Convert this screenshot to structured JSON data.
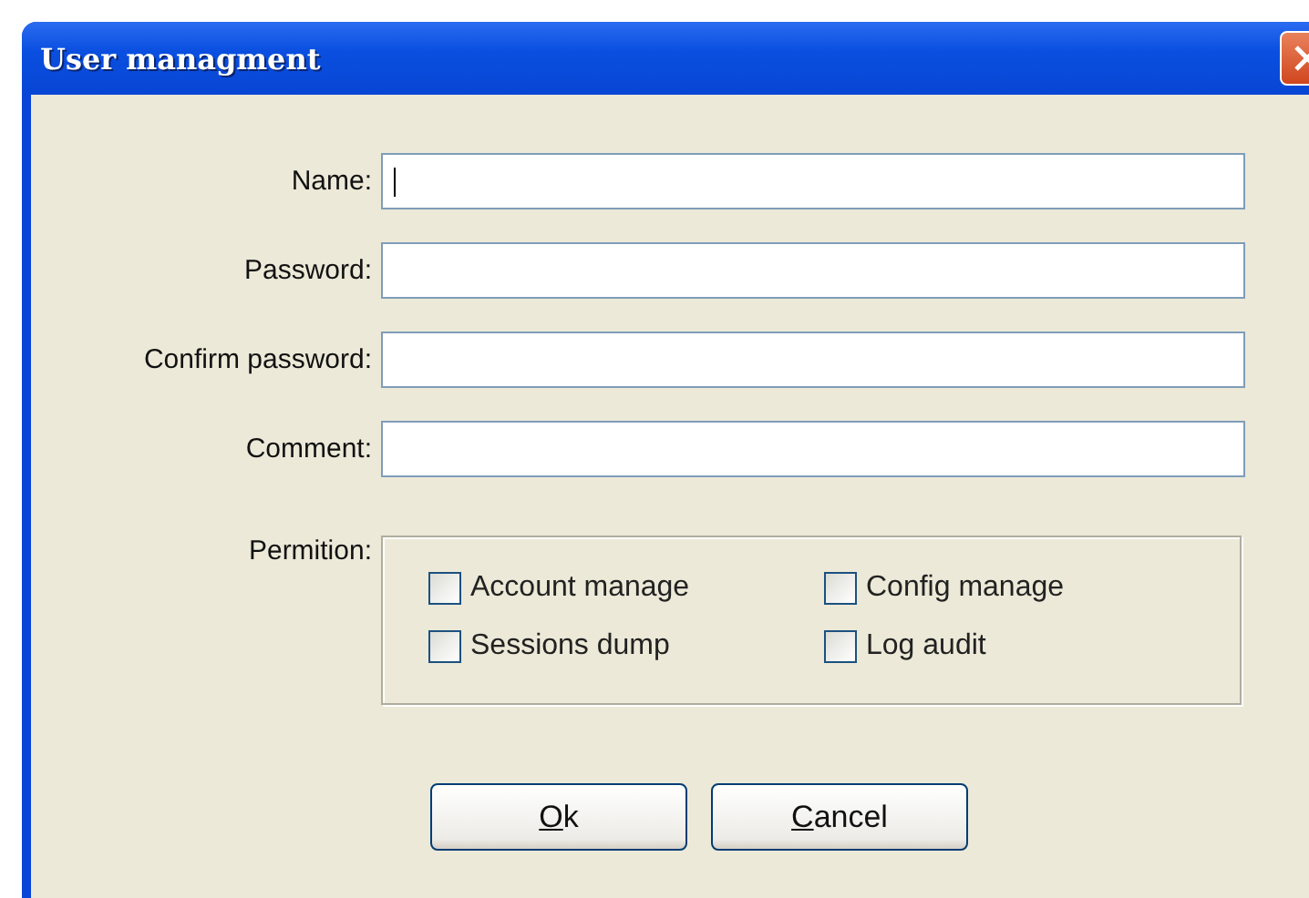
{
  "window": {
    "title": "User managment"
  },
  "fields": [
    {
      "label": "Name:",
      "focused": true
    },
    {
      "label": "Password:",
      "focused": false
    },
    {
      "label": "Confirm password:",
      "focused": false
    },
    {
      "label": "Comment:",
      "focused": false
    }
  ],
  "permissions": {
    "label": "Permition:",
    "options": [
      {
        "label": "Account manage",
        "checked": false
      },
      {
        "label": "Config manage",
        "checked": false
      },
      {
        "label": "Sessions dump",
        "checked": false
      },
      {
        "label": "Log audit",
        "checked": false
      }
    ]
  },
  "buttons": [
    {
      "label": "Ok",
      "underline_first": true
    },
    {
      "label": "Cancel",
      "underline_first": true
    }
  ]
}
